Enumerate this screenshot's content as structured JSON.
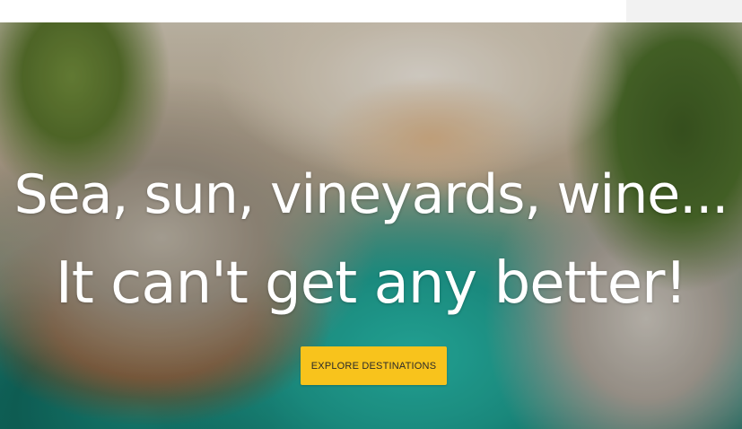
{
  "hero": {
    "headline_line1": "Sea, sun, vineyards, wine...",
    "headline_line2": "It can't get any better!",
    "cta_label": "EXPLORE DESTINATIONS",
    "cta_color": "#f8c31c",
    "background_image": "aerial-beach-photo"
  }
}
